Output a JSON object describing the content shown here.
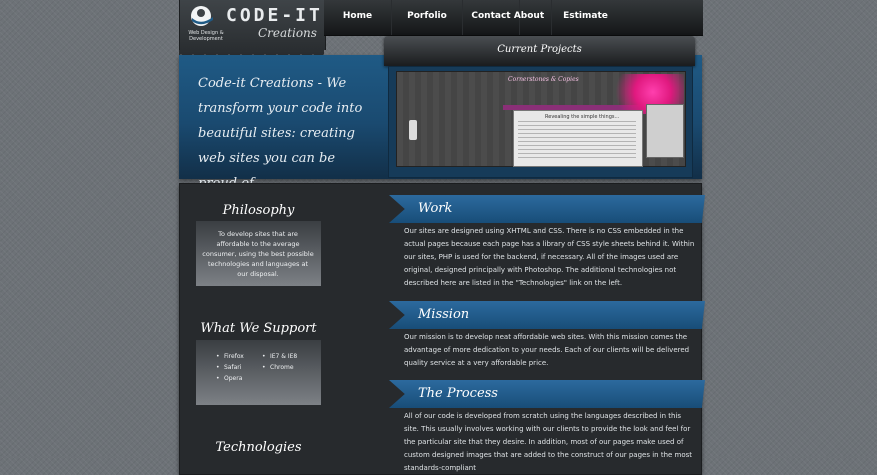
{
  "brand": {
    "name": "CODE-IT",
    "sub": "Creations",
    "tagline": "Web Design & Development"
  },
  "nav": {
    "items": [
      {
        "label": "Home"
      },
      {
        "label": "Porfolio"
      },
      {
        "label": "Contact"
      },
      {
        "label": "About"
      },
      {
        "label": "Estimate"
      }
    ]
  },
  "hero": {
    "text": "Code-it Creations - We transform your code into beautiful sites: creating web sites you can be proud of..."
  },
  "current_projects": {
    "title": "Current Projects",
    "screenshot": {
      "site_title": "Cornerstones & Copies",
      "heading": "Revealing the simple things..."
    }
  },
  "sidebar": {
    "philosophy": {
      "title": "Philosophy",
      "text": "To develop sites that are affordable to the average consumer, using the best possible technologies and languages at our disposal."
    },
    "support": {
      "title": "What We Support",
      "col1": [
        "Firefox",
        "Safari",
        "Opera"
      ],
      "col2": [
        "IE7 & IE8",
        "Chrome"
      ]
    },
    "technologies": {
      "title": "Technologies"
    }
  },
  "sections": {
    "work": {
      "title": "Work",
      "text": "Our sites are designed using XHTML and CSS. There is no CSS embedded in the actual pages because each page has a library of CSS style sheets behind it. Within our sites, PHP is used for the backend, if necessary. All of the images used are original, designed principally with Photoshop. The additional technologies not described here are listed in the \"Technologies\" link on the left."
    },
    "mission": {
      "title": "Mission",
      "text": "Our mission is to develop neat affordable web sites. With this mission comes the advantage of more dedication to your needs. Each of our clients will be delivered quality service at a very affordable price."
    },
    "process": {
      "title": "The Process",
      "text": "All of our code is developed from scratch using the languages described in this site. This usually involves working with our clients to provide the look and feel for the particular site that they desire. In addition, most of our pages make used of custom designed images that are added to the construct of our pages in the most standards-compliant"
    }
  },
  "colors": {
    "accent_blue": "#1f5a85",
    "panel_dark": "#272a2d",
    "banner_blue": "#2c6a9e"
  }
}
